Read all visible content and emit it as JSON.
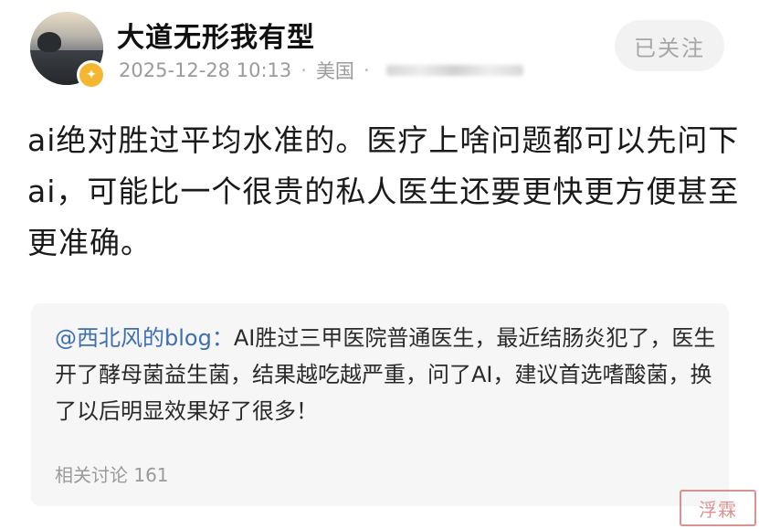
{
  "post": {
    "author": {
      "name": "大道无形我有型",
      "avatar_icon": "avatar-landscape",
      "badge_icon": "gold-verified-badge",
      "badge_color": "#f5b731"
    },
    "meta": {
      "timestamp": "2025-12-28 10:13",
      "location": "美国",
      "separator": "·"
    },
    "follow_button": {
      "label": "已关注"
    },
    "body_text": "ai绝对胜过平均水准的。医疗上啥问题都可以先问下ai，可能比一个很贵的私人医生还要更快更方便甚至更准确。"
  },
  "quote": {
    "author": "@西北风的blog：",
    "text": "AI胜过三甲医院普通医生，最近结肠炎犯了，医生开了酵母菌益生菌，结果越吃越严重，问了AI，建议首选嗜酸菌，换了以后明显效果好了很多！",
    "related_label": "相关讨论 161",
    "author_color": "#3d6fb0"
  },
  "watermark": {
    "text": "浮霖",
    "color": "#d77d7d"
  }
}
